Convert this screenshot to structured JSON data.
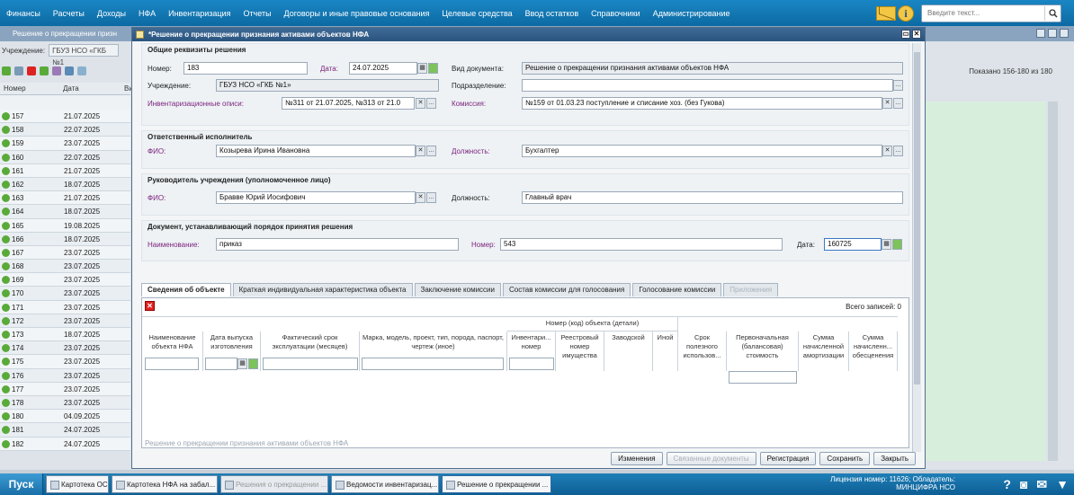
{
  "menu": [
    "Финансы",
    "Расчеты",
    "Доходы",
    "НФА",
    "Инвентаризация",
    "Отчеты",
    "Договоры и иные правовые основания",
    "Целевые средства",
    "Ввод остатков",
    "Справочники",
    "Администрирование"
  ],
  "search": {
    "placeholder": "Введите текст..."
  },
  "bg_window": {
    "title": "Решение о прекращении призн",
    "filter_label": "Учреждение:",
    "filter_value": "ГБУЗ НСО «ГКБ №1",
    "shown": "Показано 156-180 из 180",
    "col_number": "Номер",
    "col_date": "Дата",
    "col_vi": "Ви",
    "rows": [
      {
        "n": "157",
        "d": "21.07.2025"
      },
      {
        "n": "158",
        "d": "22.07.2025"
      },
      {
        "n": "159",
        "d": "23.07.2025"
      },
      {
        "n": "160",
        "d": "22.07.2025"
      },
      {
        "n": "161",
        "d": "21.07.2025"
      },
      {
        "n": "162",
        "d": "18.07.2025"
      },
      {
        "n": "163",
        "d": "21.07.2025"
      },
      {
        "n": "164",
        "d": "18.07.2025"
      },
      {
        "n": "165",
        "d": "19.08.2025"
      },
      {
        "n": "166",
        "d": "18.07.2025"
      },
      {
        "n": "167",
        "d": "23.07.2025"
      },
      {
        "n": "168",
        "d": "23.07.2025"
      },
      {
        "n": "169",
        "d": "23.07.2025"
      },
      {
        "n": "170",
        "d": "23.07.2025"
      },
      {
        "n": "171",
        "d": "23.07.2025"
      },
      {
        "n": "172",
        "d": "23.07.2025"
      },
      {
        "n": "173",
        "d": "18.07.2025"
      },
      {
        "n": "174",
        "d": "23.07.2025"
      },
      {
        "n": "175",
        "d": "23.07.2025"
      },
      {
        "n": "176",
        "d": "23.07.2025"
      },
      {
        "n": "177",
        "d": "23.07.2025"
      },
      {
        "n": "178",
        "d": "23.07.2025"
      },
      {
        "n": "180",
        "d": "04.09.2025"
      },
      {
        "n": "181",
        "d": "24.07.2025"
      },
      {
        "n": "182",
        "d": "24.07.2025"
      }
    ]
  },
  "dialog": {
    "title": "*Решение о прекращении признания активами объектов НФА",
    "sec_general": "Общие реквизиты решения",
    "number_label": "Номер:",
    "number_value": "183",
    "date_label": "Дата:",
    "date_value": "24.07.2025",
    "doctype_label": "Вид документа:",
    "doctype_value": "Решение о прекращении признания активами объектов НФА",
    "org_label": "Учреждение:",
    "org_value": "ГБУЗ НСО «ГКБ №1»",
    "division_label": "Подразделение:",
    "division_value": "",
    "inv_label": "Инвентаризационные описи:",
    "inv_value": "№311 от 21.07.2025, №313 от 21.0",
    "commission_label": "Комиссия:",
    "commission_value": "№159 от 01.03.23 поступление и списание хоз. (без Гукова)",
    "sec_executor": "Ответственный исполнитель",
    "fio_label": "ФИО:",
    "exec_fio": "Козырева Ирина Ивановна",
    "post_label": "Должность:",
    "exec_post": "Бухгалтер",
    "sec_head": "Руководитель учреждения (уполномоченное лицо)",
    "head_fio": "Бравве Юрий Иосифович",
    "head_post": "Главный врач",
    "sec_basis": "Документ, устанавливающий порядок принятия решения",
    "name_label": "Наименование:",
    "basis_name": "приказ",
    "num_label": "Номер:",
    "basis_num": "543",
    "date2_label": "Дата:",
    "basis_date": "160725",
    "tabs": [
      "Сведения об объекте",
      "Краткая индивидуальная характеристика объекта",
      "Заключение комиссии",
      "Состав комиссии для голосования",
      "Голосование комиссии",
      "Приложения"
    ],
    "total": "Всего записей:  0",
    "group_header": "Номер (код) объекта (детали)",
    "cols": [
      "Наименование объекта НФА",
      "Дата выпуска изготовления",
      "Фактический срок эксплуатации (месяцев)",
      "Марка, модель, проект, тип, порода, паспорт, чертеж (иное)",
      "Инвентари... номер",
      "Реестровый номер имущества",
      "Заводской",
      "Иной",
      "Срок полезного использов...",
      "Первоначальная (балансовая) стоимость",
      "Сумма начисленной амортизации",
      "Сумма начисленн... обесценения"
    ],
    "status_ghost": "Решение о прекращении признания активами объектов НФА",
    "buttons": [
      "Изменения",
      "Связанные документы",
      "Регистрация",
      "Сохранить",
      "Закрыть"
    ]
  },
  "taskbar": {
    "start": "Пуск",
    "tasks": [
      "Картотека ОС",
      "Картотека НФА на забал...",
      "Решения о прекращении ...",
      "Ведомости инвентаризац...",
      "Решение о прекращении ..."
    ],
    "license_line1": "Лицензия номер: 11626; Обладатель:",
    "license_line2": "МИНЦИФРА НСО"
  }
}
